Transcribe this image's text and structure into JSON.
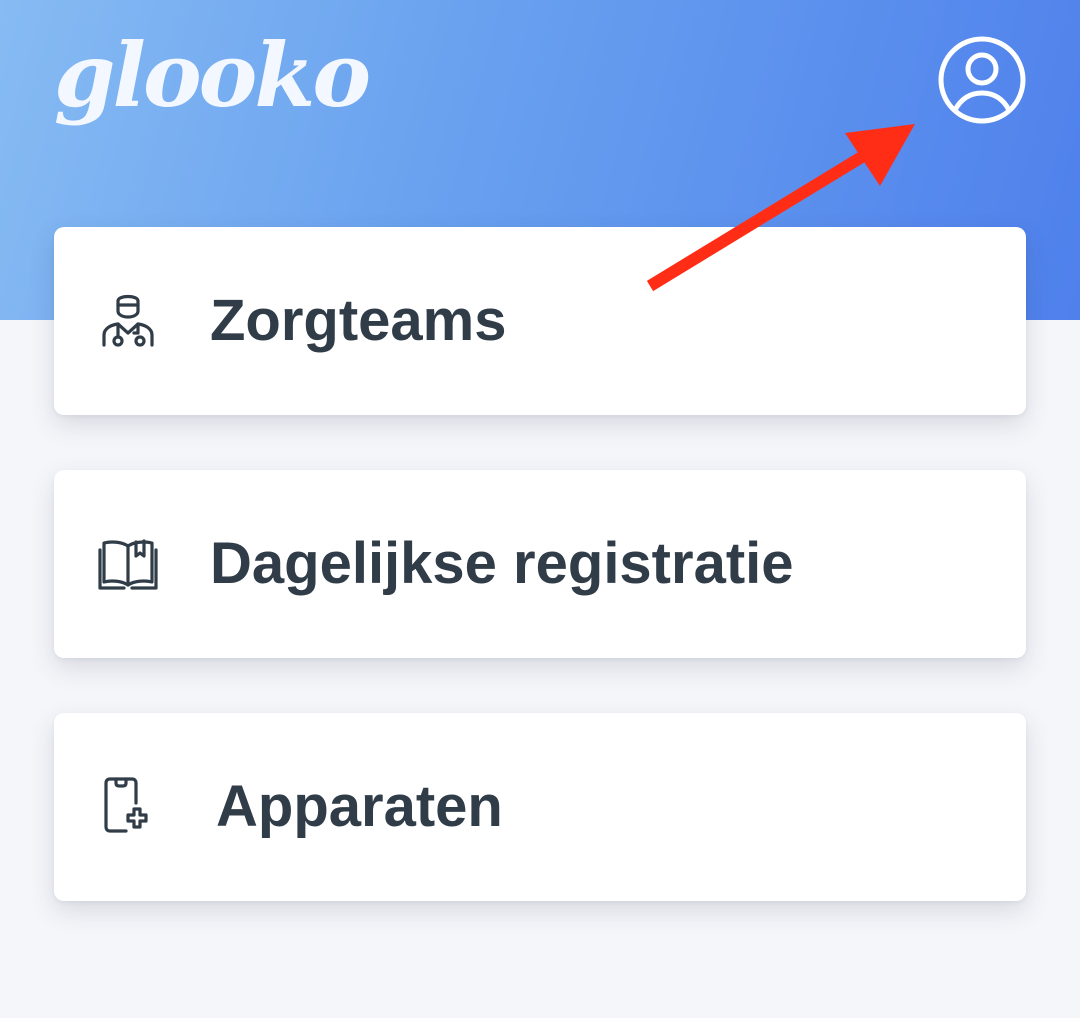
{
  "app": {
    "logo_text": "glooko"
  },
  "header": {
    "profile_icon": "user-circle-icon"
  },
  "menu": {
    "items": [
      {
        "label": "Zorgteams",
        "icon": "doctor-icon"
      },
      {
        "label": "Dagelijkse registratie",
        "icon": "book-icon"
      },
      {
        "label": "Apparaten",
        "icon": "device-plus-icon"
      }
    ]
  },
  "colors": {
    "header_gradient_start": "#86bbf3",
    "header_gradient_end": "#4f80ec",
    "annotation_arrow": "#ff2d16",
    "label_text": "#303c47",
    "page_background": "#f5f6fa"
  }
}
